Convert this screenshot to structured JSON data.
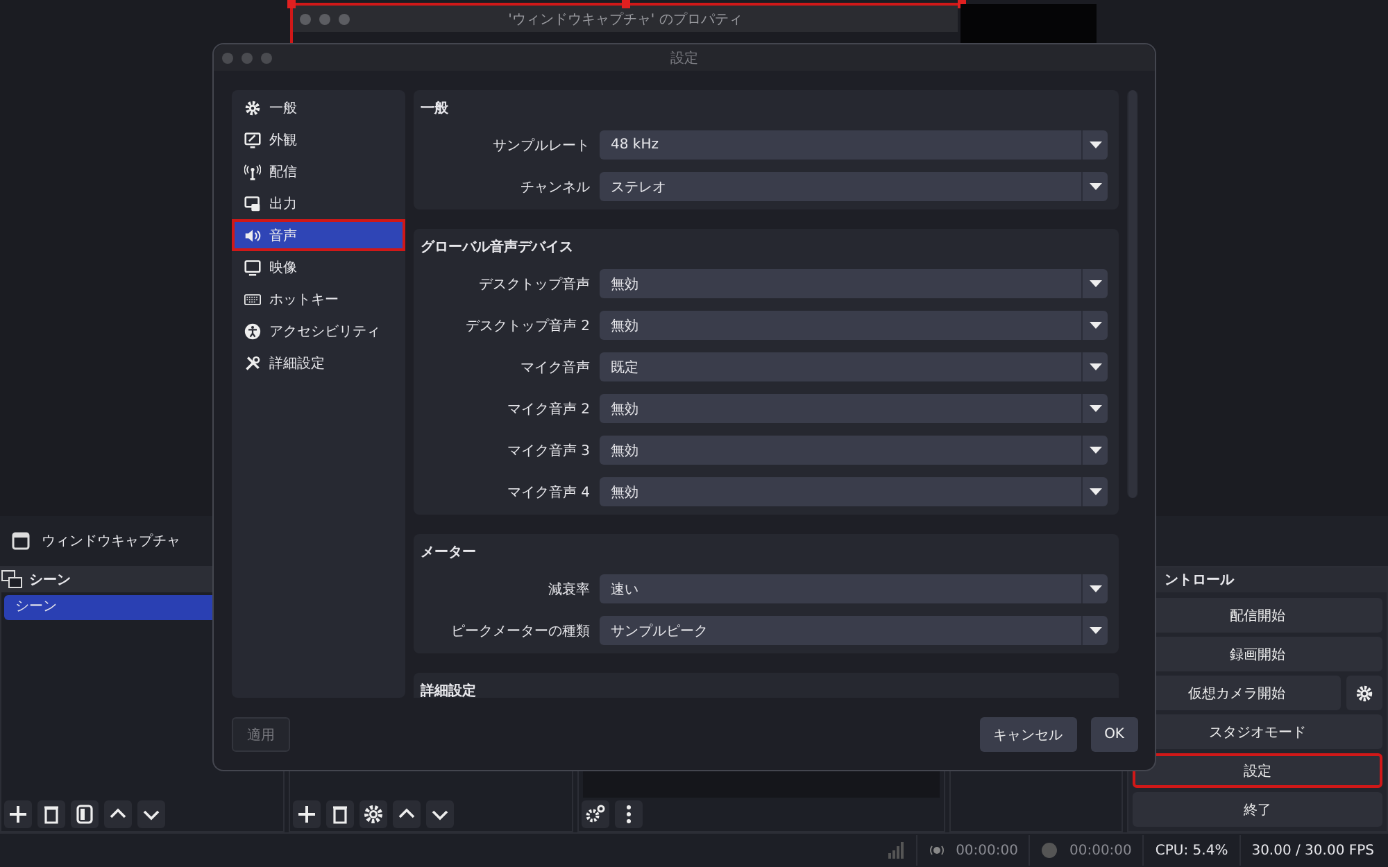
{
  "main_window": {
    "properties_window": {
      "title": "'ウィンドウキャプチャ' のプロパティ"
    },
    "source_bar": {
      "source_name": "ウィンドウキャプチャ"
    },
    "scenes_dock": {
      "title": "シーン",
      "items": [
        {
          "label": "シーン",
          "selected": true
        }
      ]
    },
    "controls_dock": {
      "title": "ントロール",
      "buttons": [
        {
          "label": "配信開始",
          "highlighted": false,
          "settings_button": false
        },
        {
          "label": "録画開始",
          "highlighted": false,
          "settings_button": false
        },
        {
          "label": "仮想カメラ開始",
          "highlighted": false,
          "settings_button": true
        },
        {
          "label": "スタジオモード",
          "highlighted": false,
          "settings_button": false
        },
        {
          "label": "設定",
          "highlighted": true,
          "settings_button": false
        },
        {
          "label": "終了",
          "highlighted": false,
          "settings_button": false
        }
      ]
    },
    "status_bar": {
      "stream_time": "00:00:00",
      "record_time": "00:00:00",
      "cpu": "CPU: 5.4%",
      "fps": "30.00 / 30.00 FPS"
    }
  },
  "settings_dialog": {
    "title": "設定",
    "sidebar": [
      {
        "label": "一般",
        "selected": false,
        "highlighted": false
      },
      {
        "label": "外観",
        "selected": false,
        "highlighted": false
      },
      {
        "label": "配信",
        "selected": false,
        "highlighted": false
      },
      {
        "label": "出力",
        "selected": false,
        "highlighted": false
      },
      {
        "label": "音声",
        "selected": true,
        "highlighted": true
      },
      {
        "label": "映像",
        "selected": false,
        "highlighted": false
      },
      {
        "label": "ホットキー",
        "selected": false,
        "highlighted": false
      },
      {
        "label": "アクセシビリティ",
        "selected": false,
        "highlighted": false
      },
      {
        "label": "詳細設定",
        "selected": false,
        "highlighted": false
      }
    ],
    "sections": [
      {
        "title": "一般",
        "rows": [
          {
            "label": "サンプルレート",
            "value": "48 kHz"
          },
          {
            "label": "チャンネル",
            "value": "ステレオ"
          }
        ]
      },
      {
        "title": "グローバル音声デバイス",
        "rows": [
          {
            "label": "デスクトップ音声",
            "value": "無効"
          },
          {
            "label": "デスクトップ音声 2",
            "value": "無効"
          },
          {
            "label": "マイク音声",
            "value": "既定"
          },
          {
            "label": "マイク音声 2",
            "value": "無効"
          },
          {
            "label": "マイク音声 3",
            "value": "無効"
          },
          {
            "label": "マイク音声 4",
            "value": "無効"
          }
        ]
      },
      {
        "title": "メーター",
        "rows": [
          {
            "label": "減衰率",
            "value": "速い"
          },
          {
            "label": "ピークメーターの種類",
            "value": "サンプルピーク"
          }
        ]
      },
      {
        "title": "詳細設定"
      }
    ],
    "buttons": {
      "apply": {
        "label": "適用",
        "disabled": true
      },
      "cancel": {
        "label": "キャンセル"
      },
      "ok": {
        "label": "OK"
      }
    }
  }
}
